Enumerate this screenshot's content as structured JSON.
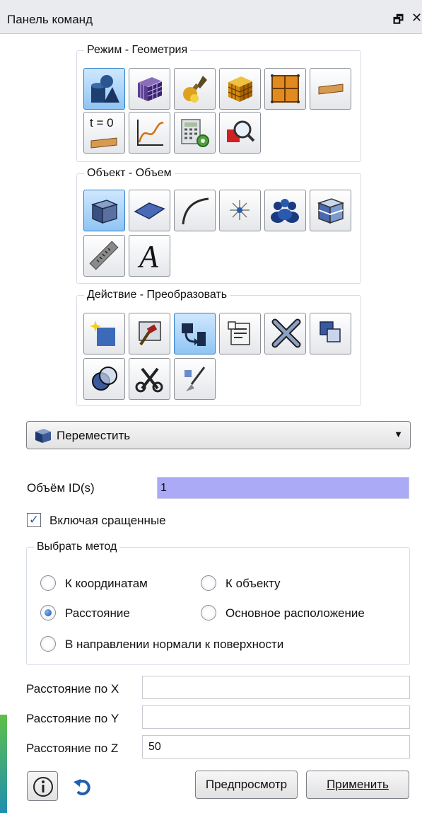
{
  "panel": {
    "title": "Панель команд"
  },
  "groups": {
    "mode": {
      "legend": "Режим - Геометрия"
    },
    "object": {
      "legend": "Объект - Объем"
    },
    "action": {
      "legend": "Действие - Преобразовать"
    }
  },
  "toolbar_mode": {
    "buttons": [
      {
        "icon": "geometry-shapes-icon",
        "active": true
      },
      {
        "icon": "mesh-cube-icon",
        "active": false
      },
      {
        "icon": "tools-wrench-icon",
        "active": false
      },
      {
        "icon": "grid-cube-icon",
        "active": false
      },
      {
        "icon": "grid-square-icon",
        "active": false
      },
      {
        "icon": "boundary-plank-icon",
        "active": false
      },
      {
        "icon": "time-zero-icon",
        "label": "t = 0",
        "active": false
      },
      {
        "icon": "curve-plot-icon",
        "active": false
      },
      {
        "icon": "calculator-gear-icon",
        "active": false
      },
      {
        "icon": "search-zoom-icon",
        "active": false
      }
    ]
  },
  "toolbar_object": {
    "buttons": [
      {
        "icon": "volume-cube-icon",
        "active": true
      },
      {
        "icon": "surface-icon",
        "active": false
      },
      {
        "icon": "curve-arc-icon",
        "active": false
      },
      {
        "icon": "vertex-star-icon",
        "active": false
      },
      {
        "icon": "group-people-icon",
        "active": false
      },
      {
        "icon": "body-box-icon",
        "active": false
      },
      {
        "icon": "ruler-icon",
        "active": false
      },
      {
        "icon": "text-a-icon",
        "label": "A",
        "active": false
      }
    ]
  },
  "toolbar_action": {
    "buttons": [
      {
        "icon": "create-new-icon",
        "active": false
      },
      {
        "icon": "modify-hammer-icon",
        "active": false
      },
      {
        "icon": "transform-move-icon",
        "active": true
      },
      {
        "icon": "properties-list-icon",
        "active": false
      },
      {
        "icon": "delete-x-icon",
        "active": false
      },
      {
        "icon": "copy-overlap-icon",
        "active": false
      },
      {
        "icon": "boolean-circles-icon",
        "active": false
      },
      {
        "icon": "cut-scissors-icon",
        "active": false
      },
      {
        "icon": "clean-brush-icon",
        "active": false
      }
    ]
  },
  "operation": {
    "selected": "Переместить"
  },
  "volume_ids": {
    "label": "Объём ID(s)",
    "value": "1"
  },
  "include_merged": {
    "label": "Включая сращенные",
    "checked": true
  },
  "method": {
    "legend": "Выбрать метод",
    "options": [
      {
        "label": "К координатам",
        "checked": false
      },
      {
        "label": "К объекту",
        "checked": false
      },
      {
        "label": "Расстояние",
        "checked": true
      },
      {
        "label": "Основное расположение",
        "checked": false
      },
      {
        "label": "В направлении нормали к поверхности",
        "checked": false
      }
    ]
  },
  "distance": {
    "x": {
      "label": "Расстояние по X",
      "value": ""
    },
    "y": {
      "label": "Расстояние по Y",
      "value": ""
    },
    "z": {
      "label": "Расстояние по Z",
      "value": "50"
    }
  },
  "buttons": {
    "preview": "Предпросмотр",
    "apply": "Применить"
  },
  "colors": {
    "active_button": "#8fc4f3",
    "id_field": "#aaaaf7",
    "accent": "#2c5fae"
  }
}
